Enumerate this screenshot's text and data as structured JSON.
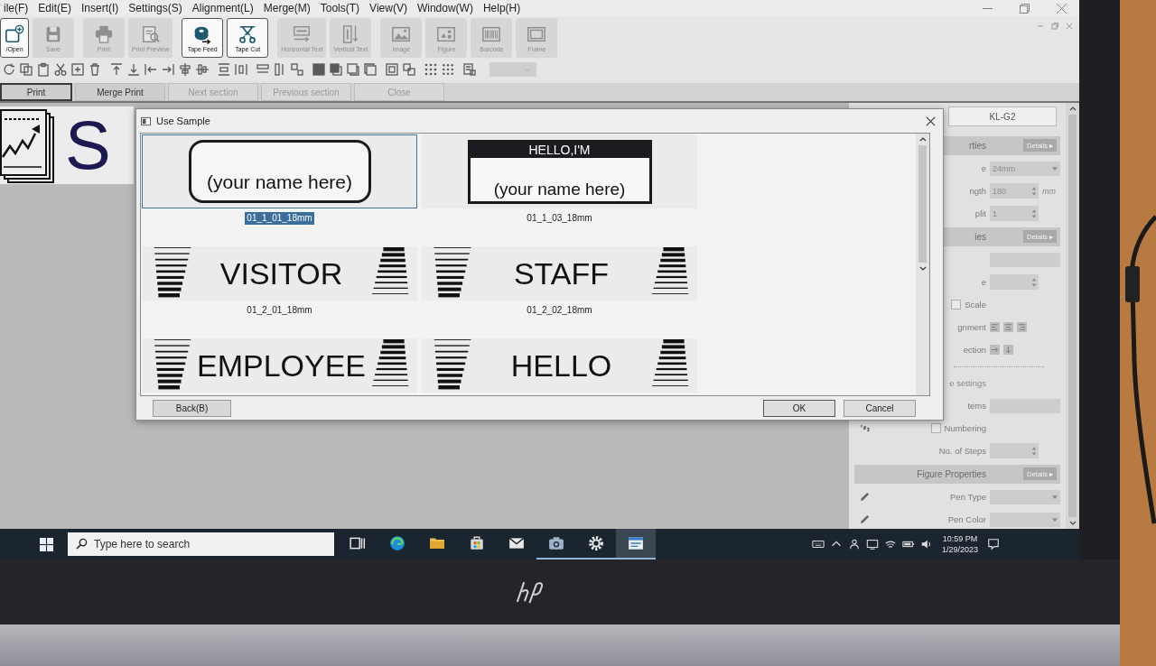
{
  "menu_bar": {
    "items": [
      "ile(F)",
      "Edit(E)",
      "Insert(I)",
      "Settings(S)",
      "Alignment(L)",
      "Merge(M)",
      "Tools(T)",
      "View(V)",
      "Window(W)",
      "Help(H)"
    ]
  },
  "toolbar": {
    "groups": [
      [
        {
          "kind": "open",
          "label": "/Open",
          "disabled": false
        },
        {
          "kind": "save",
          "label": "Save",
          "disabled": true
        }
      ],
      [
        {
          "kind": "print",
          "label": "Print",
          "disabled": true
        },
        {
          "kind": "preview",
          "label": "Print Preview",
          "disabled": true
        }
      ],
      [
        {
          "kind": "feed",
          "label": "Tape Feed",
          "disabled": false
        },
        {
          "kind": "cut",
          "label": "Tape Cut",
          "disabled": false
        }
      ],
      [
        {
          "kind": "htext",
          "label": "Horizontal Text",
          "disabled": true
        },
        {
          "kind": "vtext",
          "label": "Vertical Text",
          "disabled": true
        }
      ],
      [
        {
          "kind": "image",
          "label": "Image",
          "disabled": true
        },
        {
          "kind": "figure",
          "label": "Figure",
          "disabled": true
        },
        {
          "kind": "barcode",
          "label": "Barcode",
          "disabled": true
        },
        {
          "kind": "frame",
          "label": "Frame",
          "disabled": true
        }
      ]
    ]
  },
  "section_bar": {
    "buttons": [
      {
        "label": "Print",
        "disabled": false,
        "focused": true
      },
      {
        "label": "Merge Print",
        "disabled": false,
        "focused": false
      },
      {
        "label": "Next section",
        "disabled": true,
        "focused": false
      },
      {
        "label": "Previous section",
        "disabled": true,
        "focused": false
      },
      {
        "label": "Close",
        "disabled": true,
        "focused": false
      }
    ]
  },
  "document": {
    "text": "S"
  },
  "properties_panel": {
    "printer": "KL-G2",
    "rows": [
      {
        "kind": "header",
        "label": "rties",
        "button": "Details ▸"
      },
      {
        "kind": "select",
        "label": "e",
        "value": "24mm"
      },
      {
        "kind": "spin",
        "label": "ngth",
        "value": "180",
        "unit": "mm"
      },
      {
        "kind": "spin",
        "label": "plit",
        "value": "1"
      },
      {
        "kind": "header",
        "label": "ies",
        "button": "Details ▸"
      },
      {
        "kind": "field"
      },
      {
        "kind": "spin",
        "label": "e"
      },
      {
        "kind": "checkbox",
        "label": "Scale",
        "checked": false
      },
      {
        "kind": "align",
        "label": "gnment"
      },
      {
        "kind": "direction",
        "label": "ection"
      },
      {
        "kind": "rule"
      },
      {
        "kind": "caption",
        "label": "e settings"
      },
      {
        "kind": "field",
        "label": "tems"
      },
      {
        "kind": "checkbox",
        "label": "Numbering",
        "checked": false,
        "icon": true
      },
      {
        "kind": "spin",
        "label": "No. of Steps"
      },
      {
        "kind": "header",
        "label": "Figure Properties",
        "button": "Details ▸"
      },
      {
        "kind": "select",
        "label": "Pen Type",
        "icon": true
      },
      {
        "kind": "select",
        "label": "Pen Color",
        "icon": true
      }
    ]
  },
  "dialog": {
    "title": "Use Sample",
    "sample_rows": [
      [
        {
          "kind": "rounded",
          "text": "(your name here)",
          "caption": "01_1_01_18mm",
          "selected": true
        },
        {
          "kind": "header",
          "header": "HELLO,I'M",
          "text": "(your name here)",
          "caption": "01_1_03_18mm",
          "selected": false
        }
      ],
      [
        {
          "kind": "stripes",
          "text": "VISITOR",
          "caption": "01_2_01_18mm",
          "selected": false
        },
        {
          "kind": "stripes",
          "text": "STAFF",
          "caption": "01_2_02_18mm",
          "selected": false
        }
      ],
      [
        {
          "kind": "stripes",
          "text": "EMPLOYEE",
          "selected": false
        },
        {
          "kind": "stripes",
          "text": "HELLO",
          "selected": false
        }
      ]
    ],
    "back": "Back(B)",
    "ok": "OK",
    "cancel": "Cancel"
  },
  "taskbar": {
    "search": {
      "placeholder": "Type here to search"
    },
    "apps": [
      {
        "kind": "taskview",
        "running": false,
        "selected": false
      },
      {
        "kind": "browser",
        "running": false,
        "selected": false
      },
      {
        "kind": "folder",
        "running": false,
        "selected": false
      },
      {
        "kind": "store",
        "running": false,
        "selected": false
      },
      {
        "kind": "mail",
        "running": false,
        "selected": false
      },
      {
        "kind": "camera",
        "running": true,
        "selected": false
      },
      {
        "kind": "settings",
        "running": true,
        "selected": false
      },
      {
        "kind": "app",
        "running": true,
        "selected": true
      }
    ],
    "time": "10:59 PM",
    "date": "1/29/2023"
  }
}
